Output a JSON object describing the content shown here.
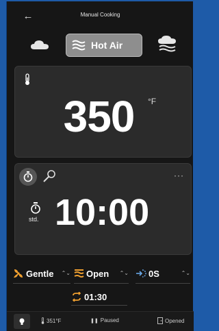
{
  "header": {
    "title": "Manual Cooking"
  },
  "modes": {
    "selected_label": "Hot Air"
  },
  "temperature": {
    "value": "350",
    "unit": "°F"
  },
  "timer": {
    "value": "10:00",
    "mode_label": "std.",
    "more": "···"
  },
  "settings": {
    "fan": "Gentle",
    "vent": "Open",
    "delay_mode": "0S",
    "delay_time": "01:30"
  },
  "status": {
    "temp": "351°F",
    "state": "Paused",
    "door": "Opened"
  },
  "colors": {
    "accent": "#f0a030",
    "background": "#161616",
    "card": "#2b2b2b",
    "frame": "#1e5ba8",
    "link": "#6aa8e8"
  }
}
